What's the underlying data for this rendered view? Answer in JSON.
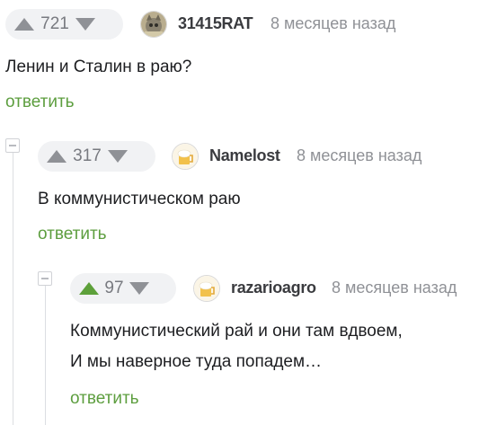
{
  "colors": {
    "vote_bg": "#f1f2f4",
    "arrow_gray": "#8f9196",
    "arrow_active_green": "#5da03a",
    "reply_green": "#5d9e3f",
    "text": "#1d1e21",
    "muted": "#8f9196"
  },
  "comments": [
    {
      "rating": "721",
      "upvoted": false,
      "author": "31415RAT",
      "avatar_icon": "cat-photo-avatar-icon",
      "time": "8 месяцев назад",
      "lines": [
        "Ленин и Сталин в раю?"
      ],
      "reply_label": "ответить"
    },
    {
      "rating": "317",
      "upvoted": false,
      "author": "Namelost",
      "avatar_icon": "default-beer-avatar-icon",
      "time": "8 месяцев назад",
      "lines": [
        "В коммунистическом раю"
      ],
      "reply_label": "ответить"
    },
    {
      "rating": "97",
      "upvoted": true,
      "author": "razarioagro",
      "avatar_icon": "default-beer-avatar-icon",
      "time": "8 месяцев назад",
      "lines": [
        "Коммунистический рай и они там вдвоем,",
        "И мы наверное туда попадем…"
      ],
      "reply_label": "ответить"
    }
  ]
}
